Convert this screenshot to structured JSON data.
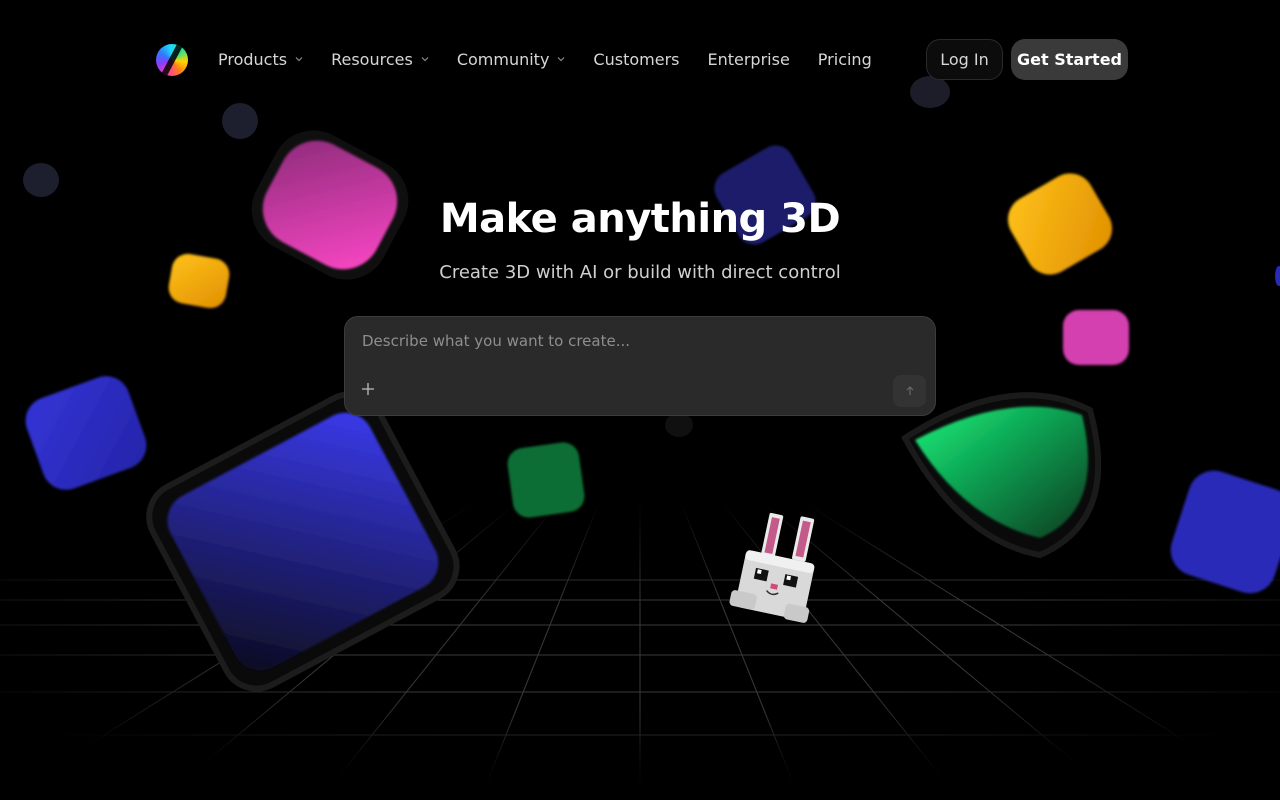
{
  "nav": {
    "logo": "Meshy logo",
    "links": [
      {
        "label": "Products",
        "has_dropdown": true
      },
      {
        "label": "Resources",
        "has_dropdown": true
      },
      {
        "label": "Community",
        "has_dropdown": true
      },
      {
        "label": "Customers",
        "has_dropdown": false
      },
      {
        "label": "Enterprise",
        "has_dropdown": false
      },
      {
        "label": "Pricing",
        "has_dropdown": false
      }
    ],
    "login_label": "Log In",
    "get_started_label": "Get Started"
  },
  "hero": {
    "title": "Make anything 3D",
    "subtitle": "Create 3D with AI or build with direct control"
  },
  "prompt": {
    "placeholder": "Describe what you want to create...",
    "value": "",
    "add_icon": "plus-icon",
    "send_icon": "arrow-up-icon"
  },
  "colors": {
    "background": "#000000",
    "prompt_bg": "#2a2a2a",
    "get_started_bg": "#3a3a3a",
    "shape_pink": "#e040b0",
    "shape_blue": "#3535e0",
    "shape_yellow": "#ffb400",
    "shape_green": "#12d46a"
  }
}
